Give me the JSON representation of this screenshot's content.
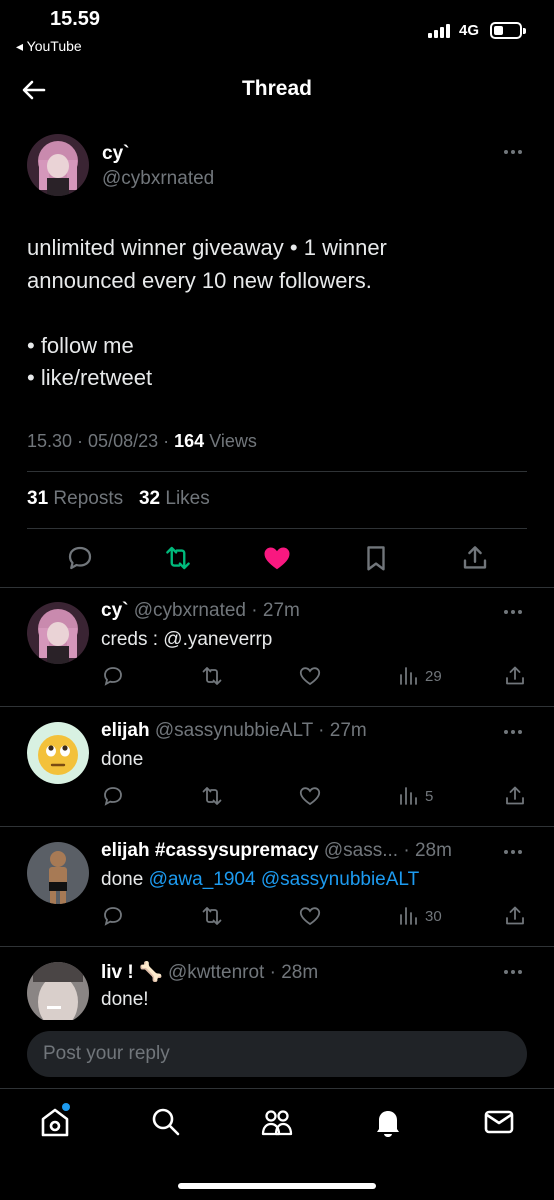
{
  "status_bar": {
    "time": "15.59",
    "back_app": "◂ YouTube",
    "network": "4G"
  },
  "header": {
    "title": "Thread"
  },
  "tweet": {
    "name": "cy`",
    "handle": "@cybxrnated",
    "lines": [
      "unlimited winner giveaway • 1 winner",
      "announced every 10 new followers.",
      "",
      "• follow me",
      "• like/retweet"
    ],
    "time": "15.30",
    "date": "05/08/23",
    "views": "164",
    "views_label": "Views",
    "reposts": "31",
    "reposts_label": "Reposts",
    "likes": "32",
    "likes_label": "Likes"
  },
  "replies": [
    {
      "name": "cy`",
      "handle": "@cybxrnated",
      "age": "27m",
      "text": "creds : @.yaneverrp",
      "views": "29"
    },
    {
      "name": "elijah",
      "handle": "@sassynubbieALT",
      "age": "27m",
      "text": "done",
      "views": "5"
    },
    {
      "name": "elijah #cassysupremacy",
      "handle": "@sass...",
      "age": "28m",
      "text": "done",
      "mentions": [
        "@awa_1904",
        "@sassynubbieALT"
      ],
      "views": "30"
    },
    {
      "name": "liv ! 🦴",
      "handle": "@kwttenrot",
      "age": "28m",
      "text": "done!"
    }
  ],
  "compose": {
    "placeholder": "Post your reply"
  },
  "colors": {
    "accent": "#1d9bf0",
    "like": "#f91880",
    "repost": "#00ba7c",
    "divider": "#2f3336"
  },
  "icons": [
    "back-arrow-icon",
    "more-icon",
    "reply-icon",
    "retweet-icon",
    "like-icon",
    "bookmark-icon",
    "share-icon",
    "views-icon",
    "home-icon",
    "search-icon",
    "communities-icon",
    "notifications-icon",
    "messages-icon"
  ]
}
